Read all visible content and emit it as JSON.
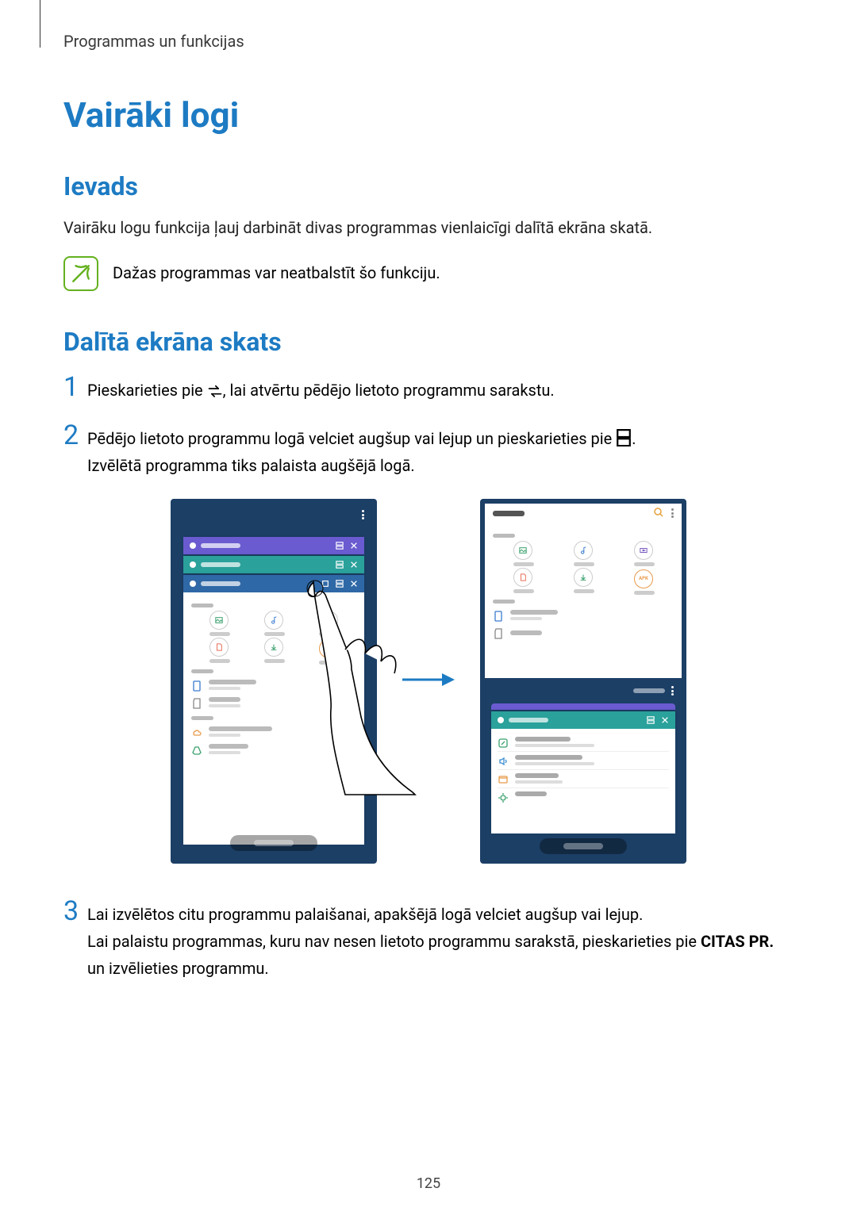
{
  "breadcrumb": "Programmas un funkcijas",
  "title": "Vairāki logi",
  "intro": {
    "heading": "Ievads",
    "paragraph": "Vairāku logu funkcija ļauj darbināt divas programmas vienlaicīgi dalītā ekrāna skatā.",
    "note": "Dažas programmas var neatbalstīt šo funkciju."
  },
  "split": {
    "heading": "Dalītā ekrāna skats",
    "steps": {
      "1": {
        "pre": "Pieskarieties pie ",
        "post": ", lai atvērtu pēdējo lietoto programmu sarakstu."
      },
      "2": {
        "line1_pre": "Pēdējo lietoto programmu logā velciet augšup vai lejup un pieskarieties pie ",
        "line1_post": ".",
        "line2": "Izvēlētā programma tiks palaista augšējā logā."
      },
      "3": {
        "line1": "Lai izvēlētos citu programmu palaišanai, apakšējā logā velciet augšup vai lejup.",
        "line2_pre": "Lai palaistu programmas, kuru nav nesen lietoto programmu sarakstā, pieskarieties pie ",
        "bold": "CITAS PR.",
        "line2_post": " un izvēlieties programmu."
      }
    }
  },
  "page_number": "125"
}
